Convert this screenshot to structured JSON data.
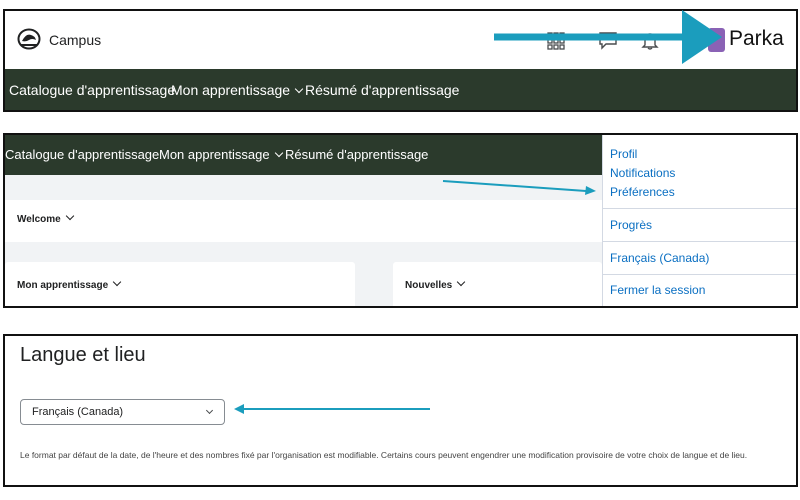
{
  "panel1": {
    "logo_text": "Campus",
    "icons": [
      "apps-grid-icon",
      "chat-icon",
      "bell-icon"
    ],
    "user_name": "Parka",
    "nav": [
      {
        "label": "Catalogue d'apprentissage"
      },
      {
        "label": "Mon apprentissage"
      },
      {
        "label": "Résumé d'apprentissage"
      }
    ]
  },
  "panel2": {
    "nav": [
      {
        "label": "Catalogue d'apprentissage"
      },
      {
        "label": "Mon apprentissage"
      },
      {
        "label": "Résumé d'apprentissage"
      }
    ],
    "welcome": "Welcome",
    "cards": [
      {
        "title": "Mon apprentissage"
      },
      {
        "title": "Nouvelles"
      }
    ],
    "menu": {
      "profil": "Profil",
      "notifications": "Notifications",
      "preferences": "Préférences",
      "progres": "Progrès",
      "langue": "Français (Canada)",
      "logout": "Fermer la session"
    }
  },
  "panel3": {
    "heading": "Langue et lieu",
    "select_value": "Français (Canada)",
    "help_text": "Le format par défaut de la date, de l'heure et des nombres fixé par l'organisation est modifiable. Certains cours peuvent engendrer une modification provisoire de votre choix de langue et de lieu."
  },
  "colors": {
    "nav_bg": "#2b3a2c",
    "link": "#0a6fc2",
    "annotation_arrow": "#1b9dbd",
    "avatar": "#8a62b5"
  }
}
